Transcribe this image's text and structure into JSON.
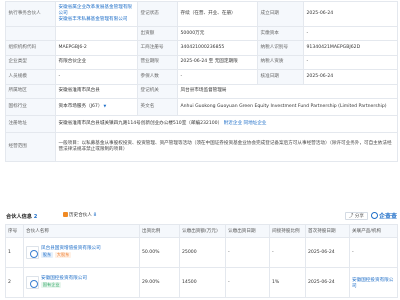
{
  "info": {
    "row1": {
      "label_legal_rep": "执行事务合伙人",
      "legal_rep_1": "安徽省属企业改革发展基金管理有限公司",
      "legal_rep_2": "安徽省丰禾私募基金管理有限公司",
      "label_reg_status": "登记状态",
      "reg_status": "存续（在营、开业、在册）",
      "label_est_date": "成立日期",
      "est_date": "2025-06-24"
    },
    "row2": {
      "label_capital": "出资额",
      "capital": "50000万元",
      "label_paid": "实缴资本",
      "paid": "-"
    },
    "row3": {
      "label_org_code": "组织机构代码",
      "org_code": "MAEPGBJ6-2",
      "label_reg_no": "工商注册号",
      "reg_no": "340421000236855",
      "label_tax_no": "纳税人识别号",
      "tax_no": "91340421MAEPGBJ62D"
    },
    "row4": {
      "label_type": "企业类型",
      "type": "有限合伙企业",
      "label_term": "营业期限",
      "term": "2025-06-24 至 无固定期限",
      "label_taxpayer": "纳税人资质",
      "taxpayer": "-"
    },
    "row5": {
      "label_staff": "人员规模",
      "staff": "-",
      "label_insured": "参保人数",
      "insured": "-",
      "label_approval": "核准日期",
      "approval": "2025-06-24"
    },
    "row6": {
      "label_region": "所属地区",
      "region": "安徽省淮南市凤台县",
      "label_authority": "登记机关",
      "authority": "凤台县市场监督管理局"
    },
    "row7": {
      "label_industry": "国标行业",
      "industry": "资本市场服务（J67）",
      "label_en_name": "英文名",
      "en_name": "Anhui Guokong Guoyuan Green Equity Investment Fund Partnership (Limited Partnership)"
    },
    "row8": {
      "label_address": "注册地址",
      "address": "安徽省淮南市凤台县城关镇四九路114号创新创业办公楼510室（邮编232100）",
      "nearby": "附近企业",
      "report_address": "同地址企业"
    },
    "row9": {
      "label_scope": "经营范围",
      "scope": "一般项目：以私募基金从事股权投资、投资管理、资产管理等活动（须在中国证券投资基金业协会完成登记备案后方可从事经营活动）（除许可业务外，可自主依法经营法律法规非禁止或限制的项目）"
    }
  },
  "shareholders": {
    "title": "合伙人信息",
    "count": "2",
    "history_label": "历史合伙人",
    "history_count": "8",
    "share_button": "分享",
    "brand": "企查查",
    "headers": [
      "序号",
      "合伙人名称",
      "出资比例",
      "认缴出资额(万元)",
      "认缴出资日期",
      "间接持股比例",
      "首次持股日期",
      "关联产品/机构"
    ],
    "rows": [
      {
        "index": "1",
        "name": "凤台县国资增值投资有限公司",
        "tag1": "股东",
        "tag2": "大股东",
        "ratio": "50.00%",
        "amount": "25000",
        "date": "-",
        "indirect": "-",
        "first_date": "2025-06-24",
        "product": "-"
      },
      {
        "index": "2",
        "name": "安徽国控投资有限公司",
        "tag1": "国有企业",
        "tag2": "",
        "ratio": "29.00%",
        "amount": "14500",
        "date": "-",
        "indirect": "1%",
        "first_date": "2025-06-24",
        "product": "安徽国控投资有限公司"
      }
    ]
  },
  "colors": {
    "accent": "#1e6ec8",
    "label_bg": "#f5f8fc",
    "border": "#e4e8ee",
    "orange": "#ee7a2a"
  }
}
